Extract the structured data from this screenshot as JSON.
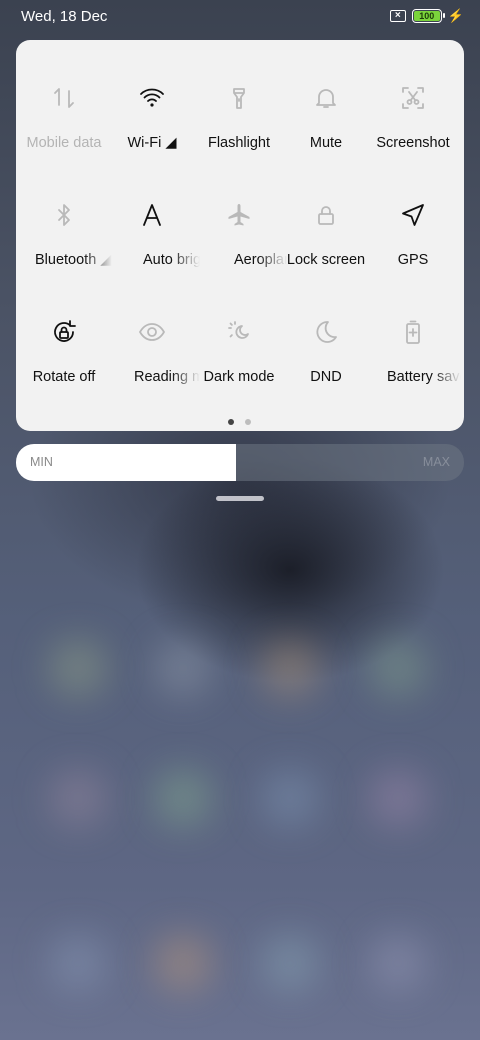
{
  "status_bar": {
    "date": "Wed, 18 Dec",
    "battery_level": "100",
    "icons": [
      "no-sim-icon",
      "battery-icon",
      "charging-bolt-icon"
    ]
  },
  "quick_settings": {
    "tiles": [
      {
        "label": "Mobile data",
        "icon": "mobile-data-icon",
        "active": false
      },
      {
        "label": "Wi-Fi",
        "icon": "wifi-icon",
        "active": true,
        "has_signal": true
      },
      {
        "label": "Flashlight",
        "icon": "flashlight-icon",
        "active": true
      },
      {
        "label": "Mute",
        "icon": "bell-icon",
        "active": true
      },
      {
        "label": "Screenshot",
        "icon": "screenshot-icon",
        "active": true
      },
      {
        "label": "Bluetooth",
        "icon": "bluetooth-icon",
        "active": true,
        "has_signal": true
      },
      {
        "label": "Auto brightness",
        "icon": "auto-brightness-icon",
        "active": true
      },
      {
        "label": "Aeroplane mode",
        "icon": "aeroplane-icon",
        "active": true
      },
      {
        "label": "Lock screen",
        "icon": "lock-icon",
        "active": true
      },
      {
        "label": "GPS",
        "icon": "gps-icon",
        "active": true
      },
      {
        "label": "Rotate off",
        "icon": "rotate-lock-icon",
        "active": true
      },
      {
        "label": "Reading mode",
        "icon": "eye-icon",
        "active": true
      },
      {
        "label": "Dark mode",
        "icon": "dark-mode-icon",
        "active": true
      },
      {
        "label": "DND",
        "icon": "moon-icon",
        "active": true
      },
      {
        "label": "Battery saver",
        "icon": "battery-saver-icon",
        "active": true
      }
    ],
    "page_count": 2,
    "current_page": 1
  },
  "brightness": {
    "min_label": "MIN",
    "max_label": "MAX",
    "level": 0.49
  },
  "colors": {
    "panel_bg": "#f2f2f2",
    "icon_active": "#111111",
    "icon_inactive": "#b9b9b9",
    "battery_green": "#7ad33b"
  }
}
